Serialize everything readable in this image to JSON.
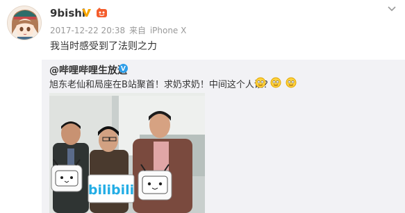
{
  "post": {
    "user_name": "9bishi",
    "timestamp": "2017-12-22 20:38",
    "source_prefix": "来自",
    "source_device": "iPhone X",
    "text": "我当时感受到了法则之力",
    "icons": {
      "avatar": "anime-girl-avatar",
      "vip": "vip-badge-icon",
      "emoji": "emoji-badge-icon",
      "menu": "chevron-down-icon"
    }
  },
  "repost": {
    "author": "@哔哩哔哩生放送",
    "text": "旭东老仙和局座在B站聚首！求奶求奶！中间这个人谁？",
    "emoji_count": 3,
    "photo_sign_text": "bilibili",
    "photo_icons": [
      "tv-plush-icon",
      "bilibili-sign-icon"
    ]
  },
  "colors": {
    "vip_gold": "#f7a600",
    "repost_bg": "#f2f2f5",
    "bilibili_blue": "#23ade5",
    "meta_gray": "#999999"
  }
}
